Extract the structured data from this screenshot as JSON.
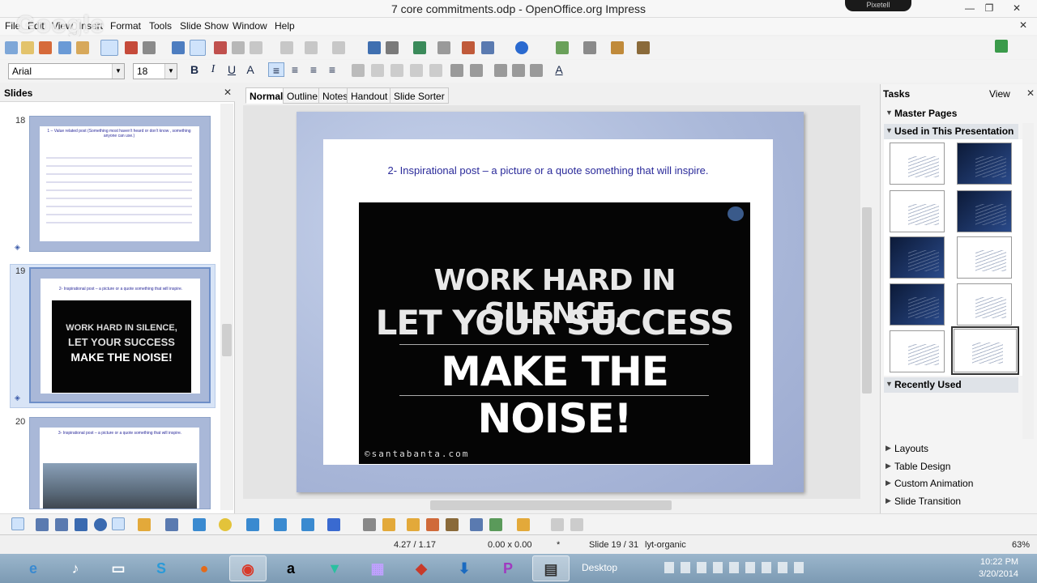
{
  "window": {
    "title": "7 core commitments.odp - OpenOffice.org Impress",
    "pixetell": "Pixetell",
    "controls": {
      "minimize": "—",
      "restore": "❐",
      "close": "✕"
    },
    "doc_close": "✕"
  },
  "watermark": "Google",
  "menu": [
    "File",
    "Edit",
    "View",
    "Insert",
    "Format",
    "Tools",
    "Slide Show",
    "Window",
    "Help"
  ],
  "font_toolbar": {
    "font_name": "Arial",
    "font_size": "18",
    "bold": "B",
    "italic": "I",
    "underline": "U",
    "shadow": "A",
    "align_left": "≡",
    "center": "≡",
    "align_right": "≡",
    "justify": "≡",
    "font_color": "A"
  },
  "slides_pane": {
    "title": "Slides",
    "close": "✕",
    "slides": [
      {
        "number": "18",
        "caption": "1 – Value related post (Something most haven't heard or don't know , something anyone can use.)"
      },
      {
        "number": "19",
        "caption": "2- Inspirational post – a picture or a quote something that will inspire.",
        "quote": [
          "WORK HARD IN SILENCE,",
          "LET YOUR SUCCESS",
          "MAKE THE NOISE!"
        ]
      },
      {
        "number": "20",
        "caption": "3- Inspirational post – a picture or a quote something that will inspire."
      }
    ]
  },
  "view_tabs": [
    {
      "label": "Normal",
      "active": true
    },
    {
      "label": "Outline",
      "active": false
    },
    {
      "label": "Notes",
      "active": false
    },
    {
      "label": "Handout",
      "active": false
    },
    {
      "label": "Slide Sorter",
      "active": false
    }
  ],
  "slide": {
    "heading": "2- Inspirational post – a picture or a quote something that will inspire.",
    "quote": [
      "WORK HARD IN SILENCE,",
      "LET YOUR SUCCESS",
      "MAKE THE NOISE!"
    ],
    "credit": "©santabanta.com"
  },
  "tasks_pane": {
    "title": "Tasks",
    "view_label": "View",
    "close": "✕",
    "master_pages": "Master Pages",
    "used": "Used in This Presentation",
    "recently_used": "Recently Used",
    "sections": [
      "Layouts",
      "Table Design",
      "Custom Animation",
      "Slide Transition"
    ],
    "master_thumbs": [
      {
        "style": "light",
        "selected": false
      },
      {
        "style": "dark",
        "selected": false
      },
      {
        "style": "light",
        "selected": false
      },
      {
        "style": "dark",
        "selected": false
      },
      {
        "style": "dark",
        "selected": false
      },
      {
        "style": "light",
        "selected": false
      },
      {
        "style": "dark",
        "selected": false
      },
      {
        "style": "light",
        "selected": false
      },
      {
        "style": "light",
        "selected": false
      },
      {
        "style": "light",
        "selected": true
      }
    ]
  },
  "status_bar": {
    "position": "4.27 / 1.17",
    "size": "0.00 x 0.00",
    "marker": "*",
    "slide": "Slide 19 / 31",
    "layout": "lyt-organic",
    "zoom": "63%"
  },
  "taskbar": {
    "apps": [
      "IE",
      "iTunes",
      "Explorer",
      "Skype",
      "Firefox",
      "Chrome",
      "Amazon",
      "App",
      "App",
      "App",
      "Download",
      "PDF",
      "Impress"
    ],
    "desktop": "Desktop",
    "time": "10:22 PM",
    "date": "3/20/2014"
  },
  "colors": {
    "accent": "#7da2ce",
    "slide_text": "#2a2a9a",
    "taskbar": "#8aa8c0"
  }
}
